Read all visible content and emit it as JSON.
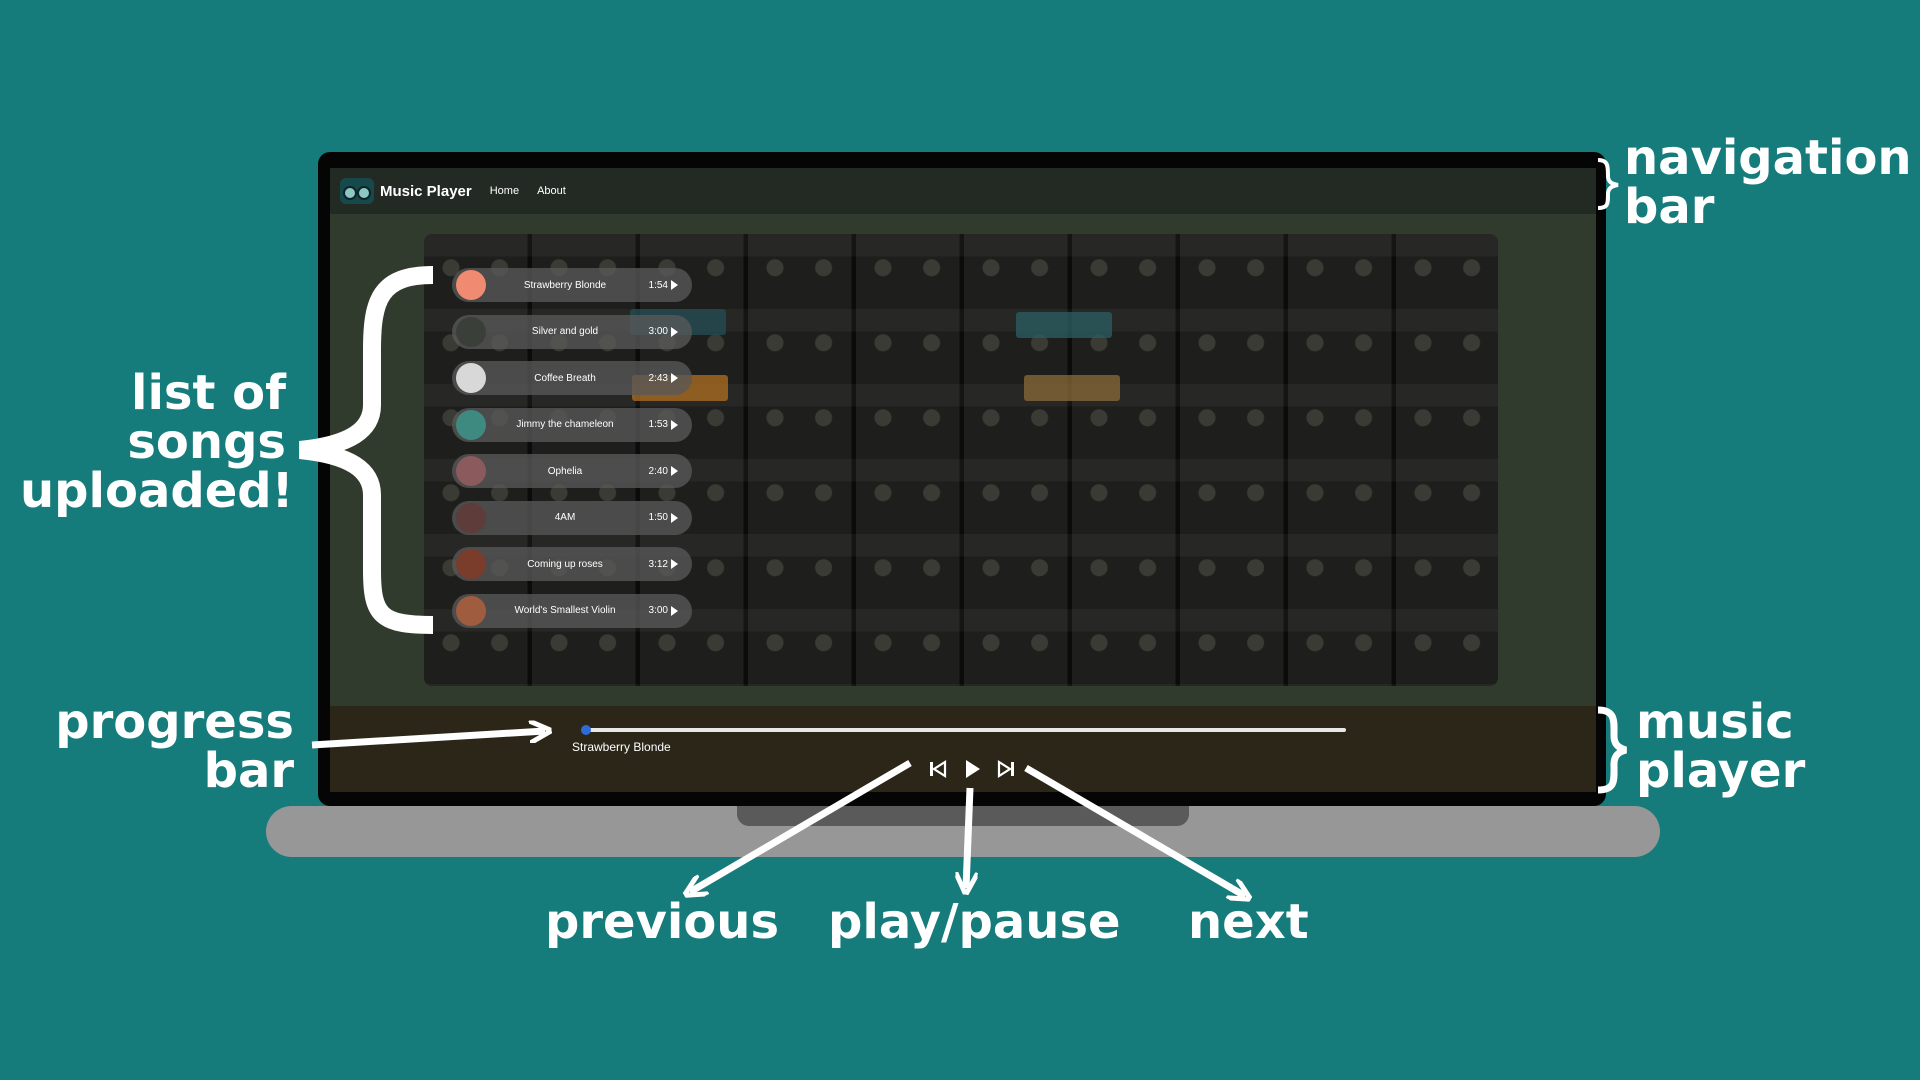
{
  "annotations": {
    "navigation_bar": [
      "navigation",
      "bar"
    ],
    "list_of_songs": [
      "list of",
      "songs",
      "uploaded!"
    ],
    "progress_bar": [
      "progress",
      "bar"
    ],
    "music_player": [
      "music",
      "player"
    ],
    "previous": "previous",
    "play_pause": "play/pause",
    "next": "next"
  },
  "app": {
    "brand": "Music Player",
    "nav": [
      "Home",
      "About"
    ]
  },
  "songs": [
    {
      "title": "Strawberry Blonde",
      "duration": "1:54",
      "thumb_color": "#f08a70"
    },
    {
      "title": "Silver and gold",
      "duration": "3:00",
      "thumb_color": "#3b3f39"
    },
    {
      "title": "Coffee Breath",
      "duration": "2:43",
      "thumb_color": "#d8d8d8"
    },
    {
      "title": "Jimmy the chameleon",
      "duration": "1:53",
      "thumb_color": "#3f8a80"
    },
    {
      "title": "Ophelia",
      "duration": "2:40",
      "thumb_color": "#8a5a5c"
    },
    {
      "title": "4AM",
      "duration": "1:50",
      "thumb_color": "#5d3c3a"
    },
    {
      "title": "Coming up roses",
      "duration": "3:12",
      "thumb_color": "#7a3d2c"
    },
    {
      "title": "World's Smallest Violin",
      "duration": "3:00",
      "thumb_color": "#a05c3e"
    }
  ],
  "player": {
    "now_playing": "Strawberry Blonde",
    "progress": 0.0,
    "accent_color": "#2f6bd6"
  },
  "icons": [
    "boombox-icon",
    "play-icon",
    "previous-icon",
    "next-icon"
  ]
}
